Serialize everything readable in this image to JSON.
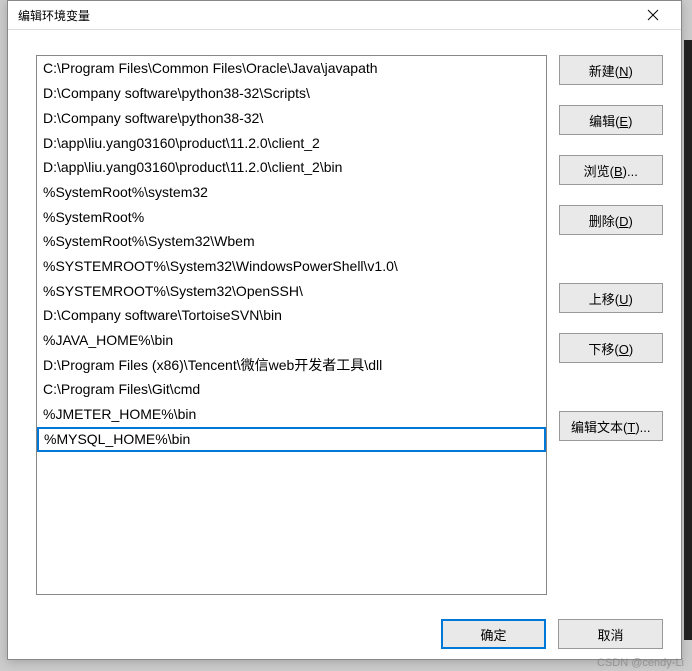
{
  "title": "编辑环境变量",
  "items": [
    "C:\\Program Files\\Common Files\\Oracle\\Java\\javapath",
    "D:\\Company software\\python38-32\\Scripts\\",
    "D:\\Company software\\python38-32\\",
    "D:\\app\\liu.yang03160\\product\\11.2.0\\client_2",
    "D:\\app\\liu.yang03160\\product\\11.2.0\\client_2\\bin",
    "%SystemRoot%\\system32",
    "%SystemRoot%",
    "%SystemRoot%\\System32\\Wbem",
    "%SYSTEMROOT%\\System32\\WindowsPowerShell\\v1.0\\",
    "%SYSTEMROOT%\\System32\\OpenSSH\\",
    "D:\\Company software\\TortoiseSVN\\bin",
    "%JAVA_HOME%\\bin",
    "D:\\Program Files (x86)\\Tencent\\微信web开发者工具\\dll",
    "C:\\Program Files\\Git\\cmd",
    "%JMETER_HOME%\\bin"
  ],
  "editing_value": "%MYSQL_HOME%\\bin",
  "buttons": {
    "new": {
      "label": "新建(",
      "accel": "N",
      "tail": ")"
    },
    "edit": {
      "label": "编辑(",
      "accel": "E",
      "tail": ")"
    },
    "browse": {
      "label": "浏览(",
      "accel": "B",
      "tail": ")..."
    },
    "delete": {
      "label": "删除(",
      "accel": "D",
      "tail": ")"
    },
    "up": {
      "label": "上移(",
      "accel": "U",
      "tail": ")"
    },
    "down": {
      "label": "下移(",
      "accel": "O",
      "tail": ")"
    },
    "edit_text": {
      "label": "编辑文本(",
      "accel": "T",
      "tail": ")..."
    }
  },
  "footer": {
    "ok": "确定",
    "cancel": "取消"
  },
  "watermark": "CSDN @cendy-Li"
}
